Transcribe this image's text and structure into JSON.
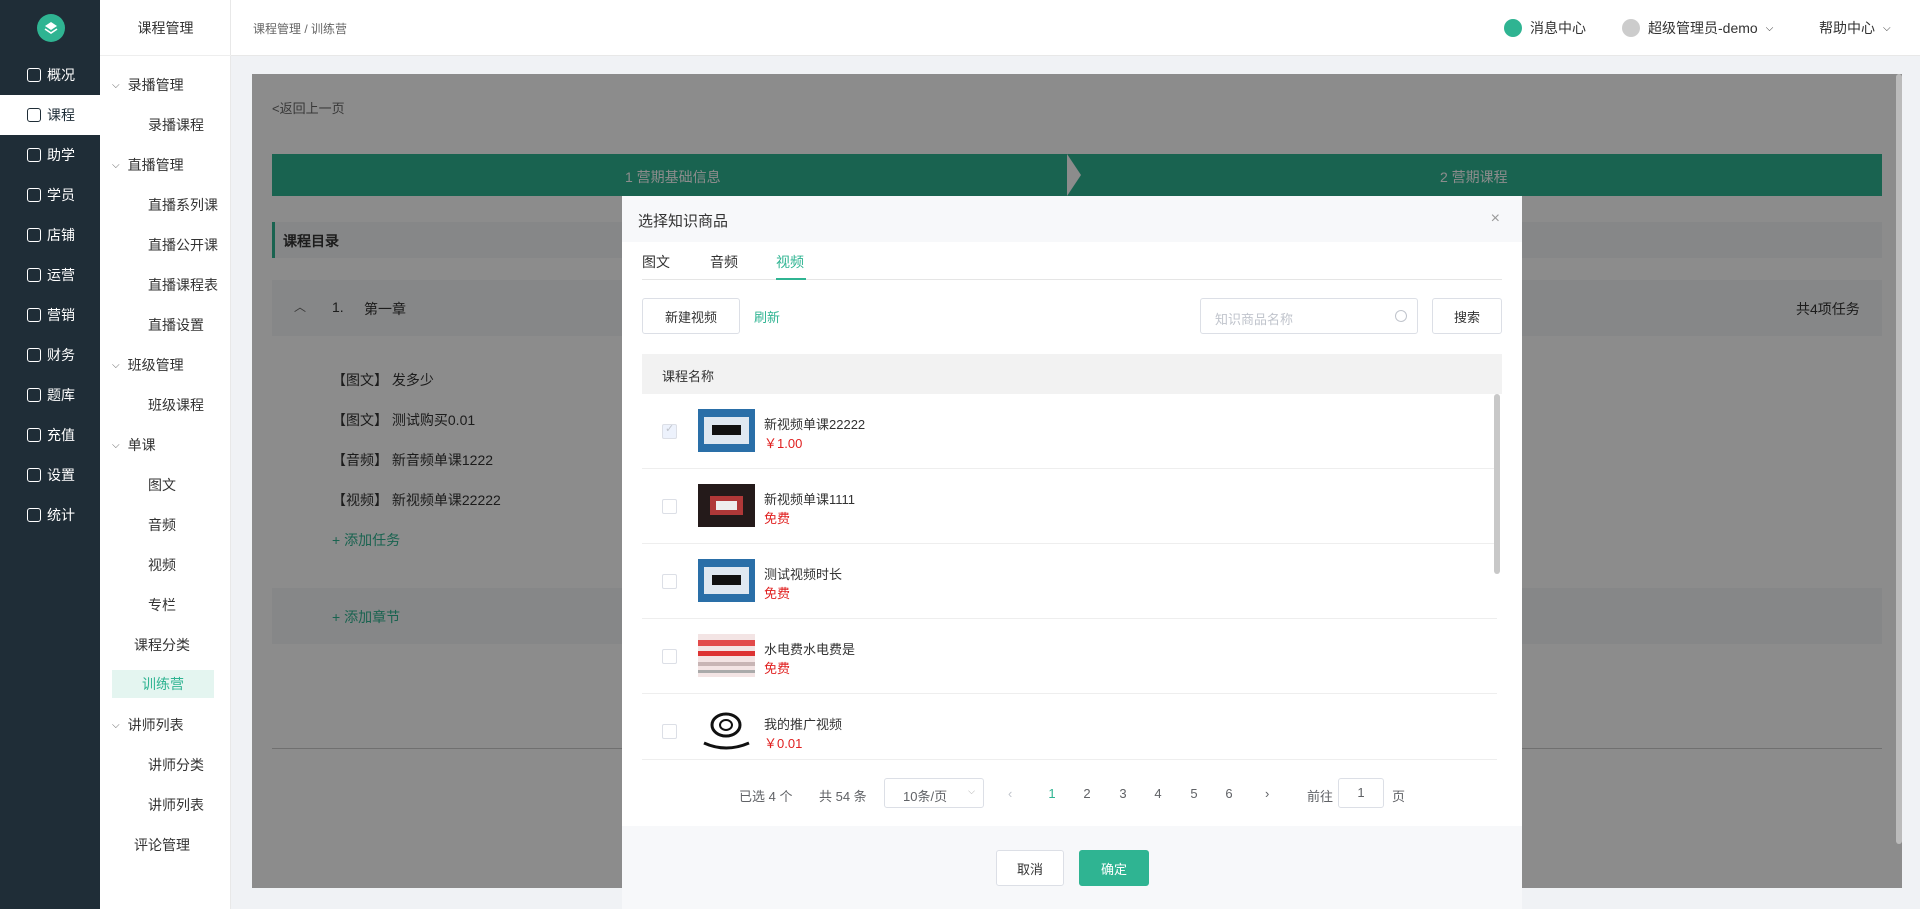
{
  "rail": {
    "items": [
      {
        "label": "概况",
        "icon": "monitor-icon"
      },
      {
        "label": "课程",
        "icon": "book-icon"
      },
      {
        "label": "助学",
        "icon": "grad-cap-icon"
      },
      {
        "label": "学员",
        "icon": "user-icon"
      },
      {
        "label": "店铺",
        "icon": "shop-icon"
      },
      {
        "label": "运营",
        "icon": "cube-icon"
      },
      {
        "label": "营销",
        "icon": "tag-icon"
      },
      {
        "label": "财务",
        "icon": "wallet-icon"
      },
      {
        "label": "题库",
        "icon": "pen-icon"
      },
      {
        "label": "充值",
        "icon": "yen-icon"
      },
      {
        "label": "设置",
        "icon": "gear-icon"
      },
      {
        "label": "统计",
        "icon": "chart-icon"
      }
    ]
  },
  "submenu": {
    "header": "课程管理",
    "g1": "录播管理",
    "g1_i1": "录播课程",
    "g2": "直播管理",
    "g2_i1": "直播系列课",
    "g2_i2": "直播公开课",
    "g2_i3": "直播课程表",
    "g2_i4": "直播设置",
    "g3": "班级管理",
    "g3_i1": "班级课程",
    "g4": "单课",
    "g4_i1": "图文",
    "g4_i2": "音频",
    "g4_i3": "视频",
    "g4_i4": "专栏",
    "l_cat": "课程分类",
    "l_camp": "训练营",
    "g5": "讲师列表",
    "g5_i1": "讲师分类",
    "g5_i2": "讲师列表",
    "l_review": "评论管理"
  },
  "topbar": {
    "breadcrumb": "课程管理 / 训练营",
    "msg": "消息中心",
    "user": "超级管理员-demo",
    "help": "帮助中心"
  },
  "page": {
    "back": "<返回上一页",
    "step1": "1 营期基础信息",
    "step2": "2 营期课程",
    "catalog": "课程目录",
    "chapter_no": "1.",
    "chapter_name": "第一章",
    "chapter_count": "共4项任务",
    "tasks": [
      "【图文】 发多少",
      "【图文】 测试购买0.01",
      "【音频】 新音频单课1222",
      "【视频】 新视频单课22222"
    ],
    "add_task": "+ 添加任务",
    "add_chapter": "+ 添加章节"
  },
  "dialog": {
    "title": "选择知识商品",
    "close": "×",
    "tabs": [
      "图文",
      "音频",
      "视频"
    ],
    "new_btn": "新建视频",
    "refresh": "刷新",
    "search_placeholder": "知识商品名称",
    "search_btn": "搜索",
    "col_header": "课程名称",
    "rows": [
      {
        "name": "新视频单课22222",
        "price": "￥1.00"
      },
      {
        "name": "新视频单课1111",
        "price": "免费"
      },
      {
        "name": "测试视频时长",
        "price": "免费"
      },
      {
        "name": "水电费水电费是",
        "price": "免费"
      },
      {
        "name": "我的推广视频",
        "price": "￥0.01"
      }
    ],
    "pager": {
      "selected": "已选 4 个",
      "total": "共 54 条",
      "page_size": "10条/页",
      "pages": [
        "1",
        "2",
        "3",
        "4",
        "5",
        "6"
      ],
      "goto": "前往",
      "goto_val": "1",
      "page_unit": "页"
    },
    "cancel": "取消",
    "ok": "确定"
  },
  "colors": {
    "accent": "#2fb492",
    "rail_bg": "#1f2d37",
    "price": "#e02020"
  }
}
